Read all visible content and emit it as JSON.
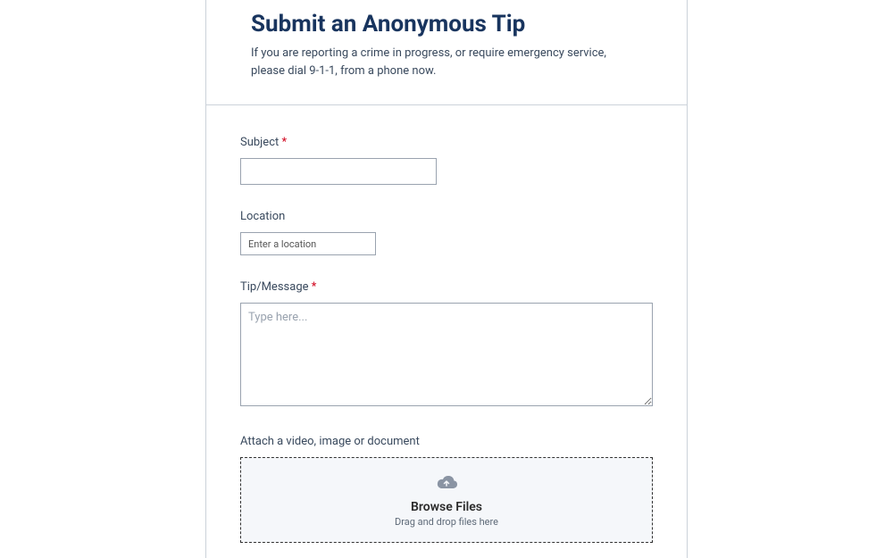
{
  "header": {
    "title": "Submit an Anonymous Tip",
    "subtitle": "If you are reporting a crime in progress, or require emergency service, please dial 9-1-1, from a phone now."
  },
  "fields": {
    "subject": {
      "label": "Subject",
      "required": "*"
    },
    "location": {
      "label": "Location",
      "placeholder": "Enter a location"
    },
    "message": {
      "label": "Tip/Message",
      "required": "*",
      "placeholder": "Type here..."
    },
    "attach": {
      "label": "Attach a video, image or document",
      "browse": "Browse Files",
      "dnd": "Drag and drop files here"
    }
  }
}
